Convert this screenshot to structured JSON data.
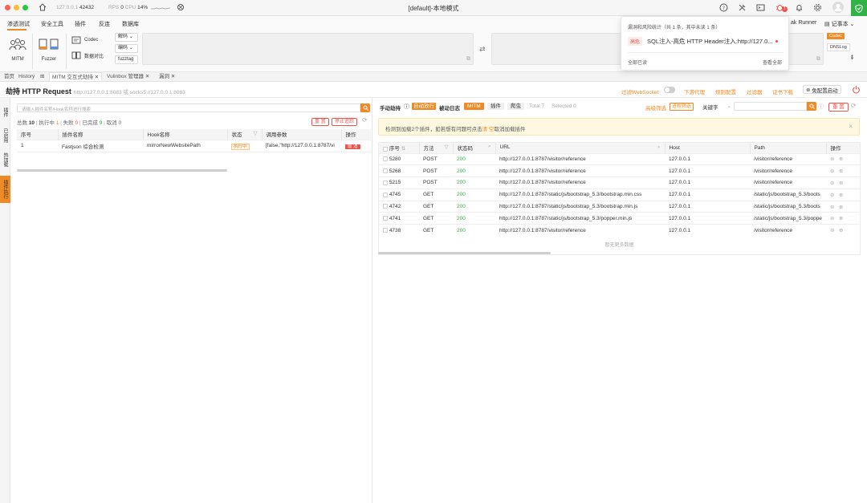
{
  "titlebar": {
    "host": "127.0.0.1",
    "port": "42432",
    "rps_label": "RPS",
    "rps_value": "0",
    "cpu_label": "CPU",
    "cpu_value": "14%",
    "window_title": "[default]-本地模式",
    "notification_badge": "1"
  },
  "menu": {
    "tabs": [
      "渗透测试",
      "安全工具",
      "插件",
      "反连",
      "数据库"
    ],
    "right_label": "ak Runner",
    "notebook_label": "记事本"
  },
  "ribbon": {
    "mitm_label": "MITM",
    "fuzzer_label": "Fuzzer",
    "codec_label": "Codec",
    "compare_label": "数据对比",
    "decode_label": "解码",
    "encode_label": "编码",
    "fuzztag_label": "fuzztag",
    "codec_chip": "Codec",
    "dnslog_chip": "DNSLog"
  },
  "popover": {
    "title": "漏洞和风险统计（共 1 条，其中未读 1 条）",
    "item_level": "高危",
    "item_text": "SQL注入-高危 HTTP Header注入:http://127.0...",
    "mark_all_read": "全部已读",
    "view_all": "查看全部"
  },
  "pagetabs": [
    {
      "label": "首页",
      "closable": false
    },
    {
      "label": "History",
      "closable": false
    },
    {
      "label": "MITM 交互式劫持",
      "closable": true
    },
    {
      "label": "Vulinbox 管理器",
      "closable": true
    },
    {
      "label": "漏洞",
      "closable": true
    }
  ],
  "hijack": {
    "title": "劫持 HTTP Request",
    "addr": "http://127.0.0.1:8083 或 socks5://127.0.0.1:8083",
    "filter_ws": "过滤WebSocket:",
    "download_cert": "下游代理",
    "rules": "规则配置",
    "filter": "过滤器",
    "cert": "证书下载",
    "free_config": "免配置启动"
  },
  "sidebar": [
    "插件",
    "已启用",
    "热加载",
    "插件执行"
  ],
  "left": {
    "search_placeholder": "请输入插件名称/Hook名称进行搜索",
    "stats": {
      "total_label": "总数",
      "total": "10",
      "running_label": "执行中",
      "running": "1",
      "failed_label": "失败",
      "failed": "0",
      "done_label": "已完成",
      "done": "9",
      "cancel_label": "取消",
      "cancel": "0"
    },
    "reset": "重 置",
    "stop_all": "停止追踪",
    "columns": [
      "序号",
      "插件名称",
      "Hook名称",
      "状态",
      "调用参数",
      "操作"
    ],
    "rows": [
      {
        "id": "1",
        "plugin": "Fastjson 综合检测",
        "hook": "mirrorNewWebsitePath",
        "status": "执行中",
        "args": "[false,\"http://127.0.0.1:8787/vi",
        "action": "取 消"
      }
    ]
  },
  "right": {
    "manual": "手动劫持",
    "auto": "自动放行",
    "passive": "被动日志",
    "mitm_tag": "MITM",
    "plugin_tag": "插件",
    "crawler_tag": "爬虫",
    "total_label": "Total",
    "total": "7",
    "selected_label": "Selected",
    "selected": "0",
    "adv_filter": "高级筛选",
    "process_filter": "进程筛选",
    "keyword": "关键字",
    "reset": "重 置",
    "warn": "检测到加载2个插件，如若想有问题可点击",
    "warn_link": "清 空",
    "warn_tail": "取消加载插件",
    "columns": [
      "序号",
      "方法",
      "状态码",
      "URL",
      "Host",
      "Path",
      "操作"
    ],
    "rows": [
      {
        "id": "5280",
        "method": "POST",
        "code": "200",
        "url": "http://127.0.0.1:8787/visitor/reference",
        "host": "127.0.0.1",
        "path": "/visitor/reference"
      },
      {
        "id": "5268",
        "method": "POST",
        "code": "200",
        "url": "http://127.0.0.1:8787/visitor/reference",
        "host": "127.0.0.1",
        "path": "/visitor/reference"
      },
      {
        "id": "5215",
        "method": "POST",
        "code": "200",
        "url": "http://127.0.0.1:8787/visitor/reference",
        "host": "127.0.0.1",
        "path": "/visitor/reference"
      },
      {
        "id": "4745",
        "method": "GET",
        "code": "200",
        "url": "http://127.0.0.1:8787/static/js/bootstrap_5.3/bootstrap.min.css",
        "host": "127.0.0.1",
        "path": "/static/js/bootstrap_5.3/boots"
      },
      {
        "id": "4742",
        "method": "GET",
        "code": "200",
        "url": "http://127.0.0.1:8787/static/js/bootstrap_5.3/bootstrap.min.js",
        "host": "127.0.0.1",
        "path": "/static/js/bootstrap_5.3/boots"
      },
      {
        "id": "4741",
        "method": "GET",
        "code": "200",
        "url": "http://127.0.0.1:8787/static/js/bootstrap_5.3/popper.min.js",
        "host": "127.0.0.1",
        "path": "/static/js/bootstrap_5.3/poppe"
      },
      {
        "id": "4738",
        "method": "GET",
        "code": "200",
        "url": "http://127.0.0.1:8787/visitor/reference",
        "host": "127.0.0.1",
        "path": "/visitor/reference"
      }
    ],
    "no_more": "暂无更多数据"
  },
  "colors": {
    "accent": "#f08a24",
    "danger": "#e9544d",
    "success": "#2fb344"
  }
}
